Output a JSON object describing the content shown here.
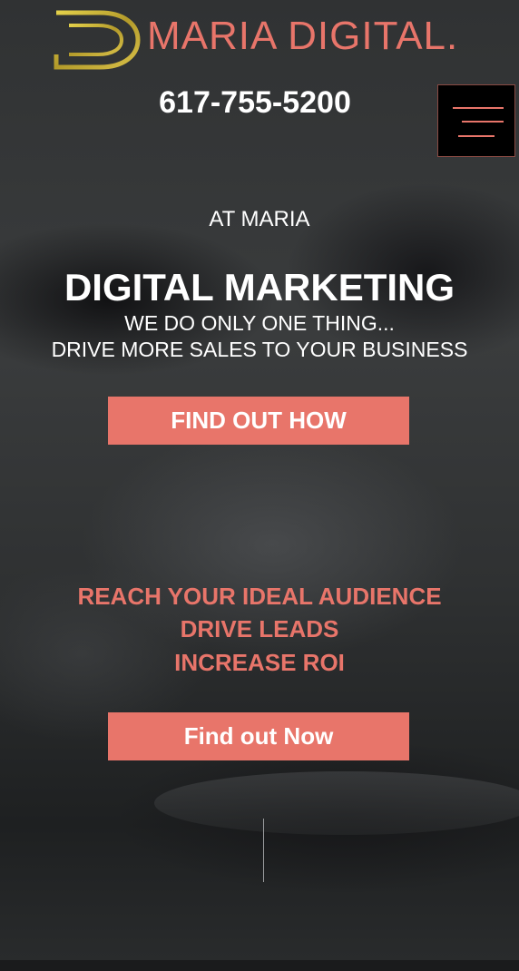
{
  "header": {
    "brand": "MARIA DIGITAL.",
    "phone": "617-755-5200",
    "logo_icon": "maria-digital-d-logo",
    "menu_icon": "hamburger-menu-icon"
  },
  "hero": {
    "intro": "AT MARIA",
    "headline": "DIGITAL MARKETING",
    "subline1": "WE DO ONLY ONE THING...",
    "subline2": "DRIVE MORE SALES TO YOUR BUSINESS",
    "cta_label": "FIND OUT HOW"
  },
  "benefits": {
    "items": [
      "REACH YOUR IDEAL AUDIENCE",
      "DRIVE LEADS",
      "INCREASE ROI"
    ],
    "cta_label": "Find out Now"
  },
  "colors": {
    "accent": "#e8756a",
    "logo_gold": "#c8b23a",
    "text": "#ffffff",
    "menu_bg": "#000000"
  }
}
